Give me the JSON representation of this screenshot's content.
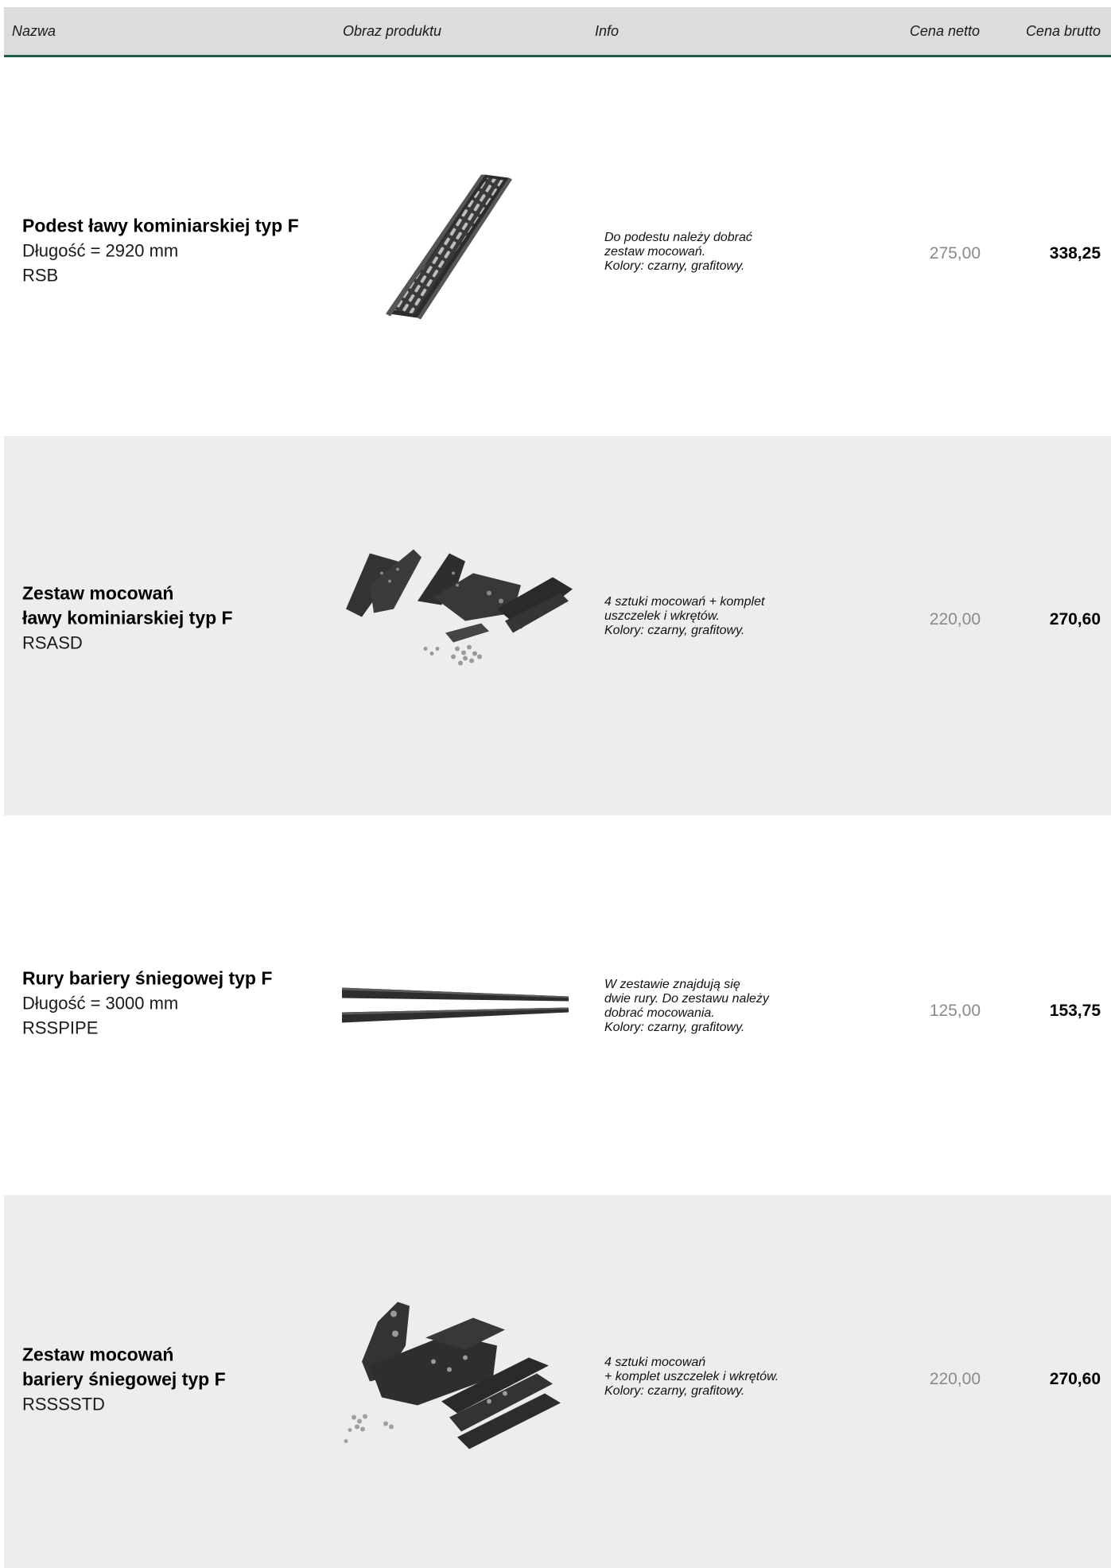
{
  "header": {
    "name": "Nazwa",
    "image": "Obraz produktu",
    "info": "Info",
    "net_price": "Cena netto",
    "gross_price": "Cena brutto"
  },
  "products": [
    {
      "title": "Podest ławy kominiarskiej typ F",
      "length": "Długość = 2920 mm",
      "code": "RSB",
      "image_icon": "roof-walkway-image",
      "info": "Do podestu należy dobrać\nzestaw mocowań.\nKolory: czarny, grafitowy.",
      "net_price": "275,00",
      "gross_price": "338,25"
    },
    {
      "title": "Zestaw mocowań\nławy kominiarskiej typ F",
      "length": "",
      "code": "RSASD",
      "image_icon": "walkway-mounting-kit-image",
      "info": "4 sztuki mocowań + komplet\nuszczelek i wkrętów.\nKolory: czarny, grafitowy.",
      "net_price": "220,00",
      "gross_price": "270,60"
    },
    {
      "title": "Rury bariery śniegowej typ F",
      "length": "Długość = 3000 mm",
      "code": "RSSPIPE",
      "image_icon": "snow-barrier-pipes-image",
      "info": "W zestawie znajdują się\ndwie rury. Do zestawu należy\ndobrać mocowania.\nKolory: czarny, grafitowy.",
      "net_price": "125,00",
      "gross_price": "153,75"
    },
    {
      "title": "Zestaw mocowań\nbariery śniegowej typ F",
      "length": "",
      "code": "RSSSSTD",
      "image_icon": "snow-barrier-mounting-kit-image",
      "info": "4 sztuki mocowań\n+ komplet uszczelek i wkrętów.\nKolory: czarny, grafitowy.",
      "net_price": "220,00",
      "gross_price": "270,60"
    }
  ],
  "colors": {
    "header_bg": "#dcdcdc",
    "header_rule": "#1f5a4a",
    "shaded_row": "#eceeed",
    "net_price": "#8a8a8a"
  }
}
